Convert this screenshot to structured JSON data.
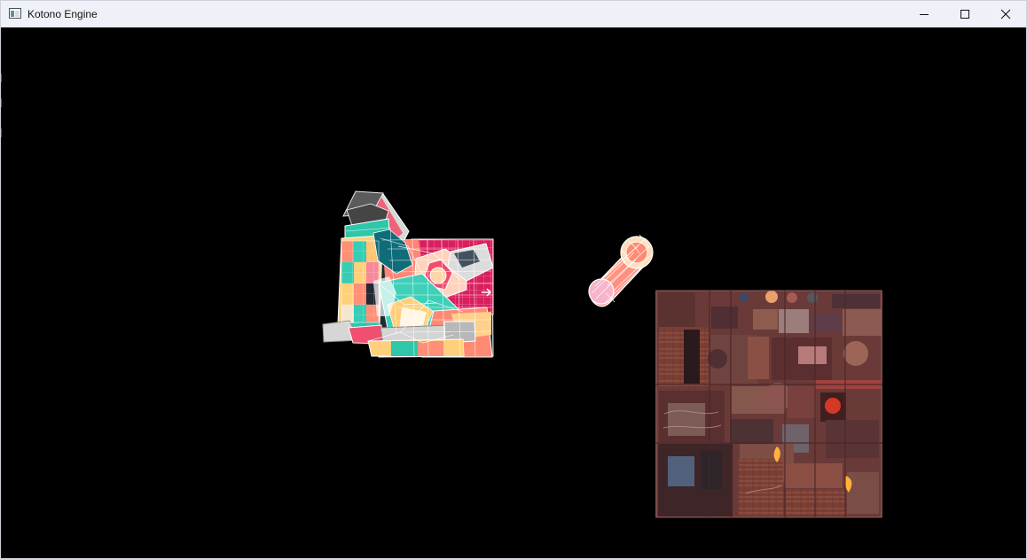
{
  "window": {
    "title": "Kotono Engine",
    "app_icon": "window-app-icon",
    "controls": {
      "minimize_icon": "minimize-icon",
      "maximize_icon": "maximize-icon",
      "close_icon": "close-icon"
    }
  },
  "viewport": {
    "background_color": "#000000",
    "objects": [
      {
        "name": "colorful-wireframe-model",
        "type": "textured 3D mesh with wireframe overlay"
      },
      {
        "name": "capsule-wireframe-model",
        "type": "small textured capsule mesh with wireframe overlay"
      },
      {
        "name": "texture-atlas-plane",
        "type": "flat textured square"
      }
    ]
  }
}
